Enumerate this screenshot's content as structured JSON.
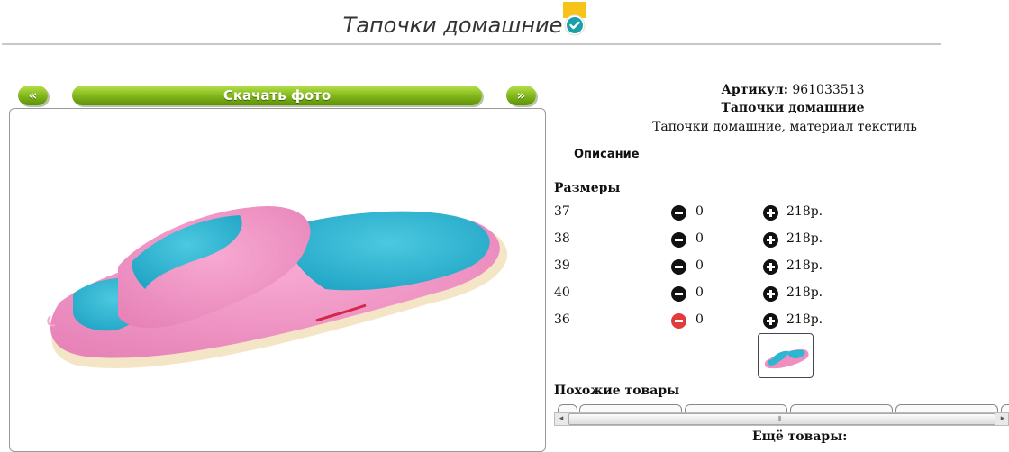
{
  "header": {
    "title": "Тапочки домашние"
  },
  "gallery": {
    "prev_label": "«",
    "download_label": "Скачать фото",
    "next_label": "»"
  },
  "product": {
    "article_label": "Артикул:",
    "article_value": "961033513",
    "name": "Тапочки домашние",
    "description": "Тапочки домашние, материал текстиль",
    "description_tab": "Описание"
  },
  "sizes": {
    "heading": "Размеры",
    "rows": [
      {
        "size": "37",
        "qty": "0",
        "price": "218р."
      },
      {
        "size": "38",
        "qty": "0",
        "price": "218р."
      },
      {
        "size": "39",
        "qty": "0",
        "price": "218р."
      },
      {
        "size": "40",
        "qty": "0",
        "price": "218р."
      },
      {
        "size": "36",
        "qty": "0",
        "price": "218р."
      }
    ]
  },
  "similar": {
    "heading": "Похожие товары",
    "scroll_left": "◂",
    "scroll_right": "▸",
    "grip": "⦀"
  },
  "more": {
    "heading": "Ещё товары:"
  },
  "colors": {
    "accent_green": "#7fb51a",
    "badge_yellow": "#f7c318",
    "badge_teal": "#1aa0a8",
    "slipper_pink": "#f08ec0",
    "slipper_blue": "#2bb6d2",
    "minus_active": "#e23b3b"
  },
  "icons": [
    "verified-badge-icon",
    "minus-icon",
    "plus-icon",
    "scroll-left-arrow-icon",
    "scroll-right-arrow-icon"
  ]
}
